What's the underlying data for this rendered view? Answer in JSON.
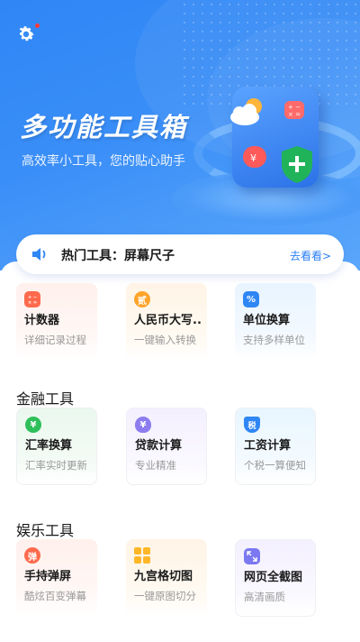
{
  "hero": {
    "title": "多功能工具箱",
    "subtitle": "高效率小工具，您的贴心助手",
    "settings_icon": "gear-icon",
    "badge_color": "#ff3b3b"
  },
  "notice": {
    "icon": "speaker-icon",
    "text": "热门工具：屏幕尺子",
    "more": "去看看>"
  },
  "sections": [
    {
      "title": "",
      "tools": [
        {
          "name": "计数器",
          "desc": "详细记录过程",
          "icon": "calculator-icon",
          "icon_text": "",
          "color": "#ff6a4d"
        },
        {
          "name": "人民币大写..",
          "desc": "一键输入转换",
          "icon": "rmb-icon",
          "icon_text": "贰",
          "color": "#ffa42b"
        },
        {
          "name": "单位换算",
          "desc": "支持多样单位",
          "icon": "percent-icon",
          "icon_text": "%",
          "color": "#2f86f5"
        }
      ]
    },
    {
      "title": "金融工具",
      "tools": [
        {
          "name": "汇率换算",
          "desc": "汇率实时更新",
          "icon": "yen-icon",
          "icon_text": "¥",
          "color": "#2fbf5a"
        },
        {
          "name": "贷款计算",
          "desc": "专业精准",
          "icon": "moneybag-icon",
          "icon_text": "¥",
          "color": "#8c7cf0"
        },
        {
          "name": "工资计算",
          "desc": "个税一算便知",
          "icon": "tax-shield-icon",
          "icon_text": "税",
          "color": "#2f86f5"
        }
      ]
    },
    {
      "title": "娱乐工具",
      "tools": [
        {
          "name": "手持弹屏",
          "desc": "酷炫百变弹幕",
          "icon": "danmaku-icon",
          "icon_text": "弹",
          "color": "#ff6a4d"
        },
        {
          "name": "九宫格切图",
          "desc": "一键原图切分",
          "icon": "grid-icon",
          "icon_text": "",
          "color": "#ffb728"
        },
        {
          "name": "网页全截图",
          "desc": "高清画质",
          "icon": "expand-icon",
          "icon_text": "",
          "color": "#7b78f0"
        }
      ]
    }
  ]
}
